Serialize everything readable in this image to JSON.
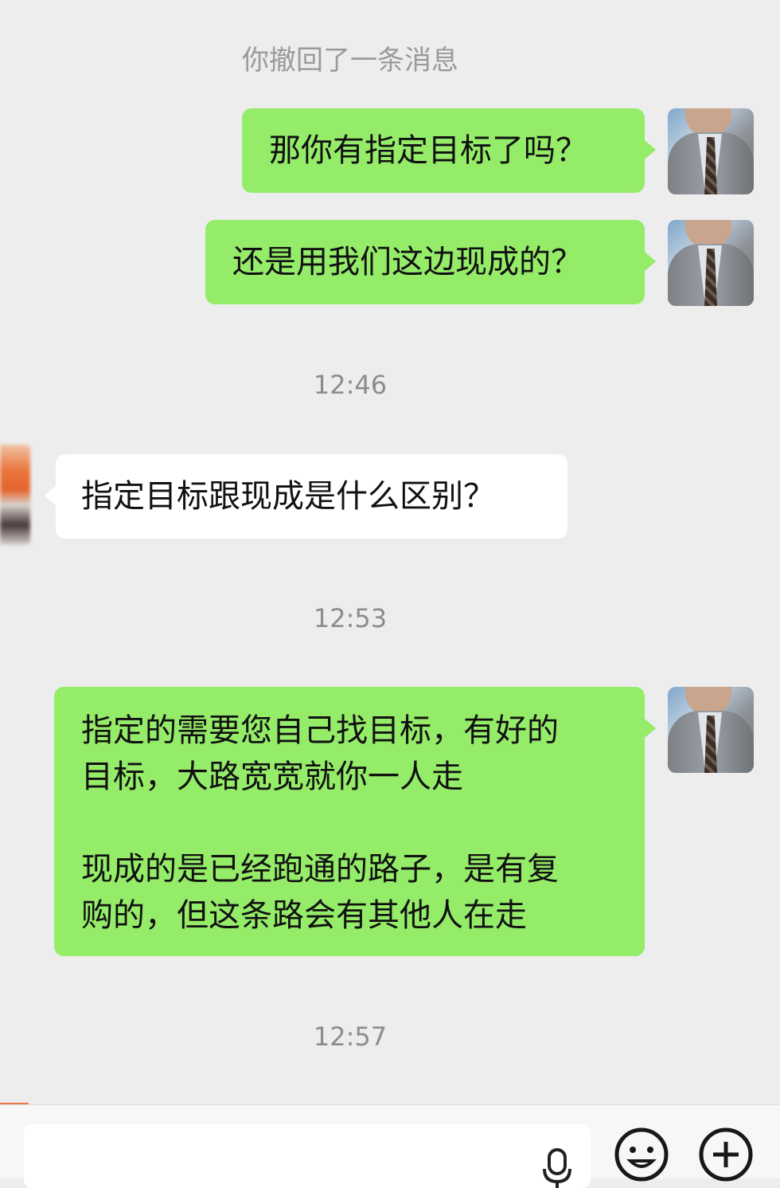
{
  "system_notice": "你撤回了一条消息",
  "messages": [
    {
      "side": "right",
      "text": "那你有指定目标了吗？"
    },
    {
      "side": "right",
      "text": "还是用我们这边现成的？"
    },
    {
      "type": "time",
      "text": "12:46"
    },
    {
      "side": "left",
      "text": "指定目标跟现成是什么区别？"
    },
    {
      "type": "time",
      "text": "12:53"
    },
    {
      "side": "right",
      "lines": [
        "指定的需要您自己找目标，有好的",
        "目标，大路宽宽就你一人走",
        "",
        "现成的是已经跑通的路子，是有复",
        "购的，但这条路会有其他人在走"
      ]
    },
    {
      "type": "time",
      "text": "12:57"
    }
  ],
  "input_bar": {
    "icons": [
      "microphone-icon",
      "emoji-icon",
      "plus-icon"
    ]
  },
  "colors": {
    "background": "#ededed",
    "my_bubble": "#95ec69",
    "their_bubble": "#ffffff",
    "timestamp": "#8c8c8c"
  }
}
